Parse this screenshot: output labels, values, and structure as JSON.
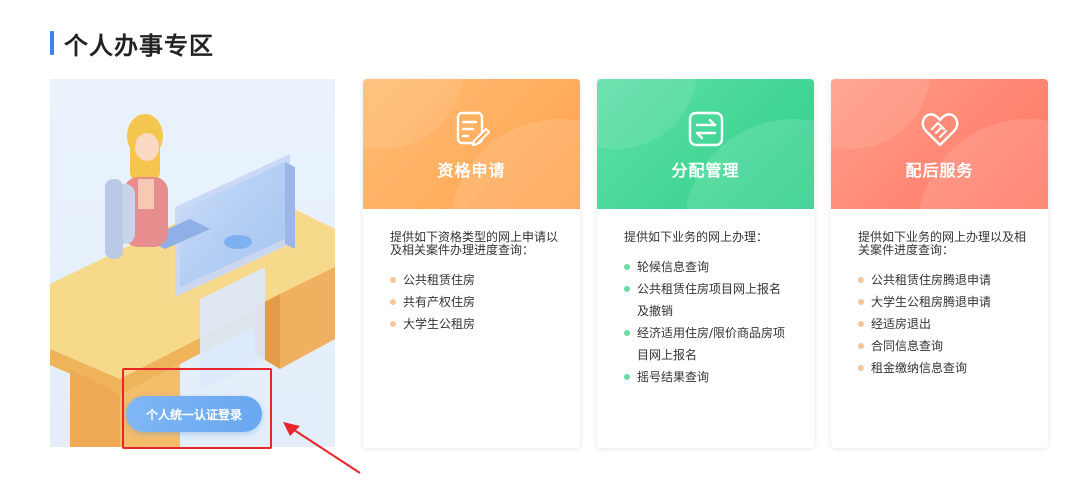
{
  "section": {
    "title": "个人办事专区"
  },
  "login": {
    "label": "个人统一认证登录"
  },
  "cards": [
    {
      "title": "资格申请",
      "icon": "form-edit-icon",
      "color": "#ffa24f",
      "dot_color": "#f7c59a",
      "desc": "提供如下资格类型的网上申请以及相关案件办理进度查询：",
      "items": [
        "公共租赁住房",
        "共有产权住房",
        "大学生公租房"
      ]
    },
    {
      "title": "分配管理",
      "icon": "exchange-arrows-icon",
      "color": "#2fcf8a",
      "dot_color": "#6fd9a6",
      "desc": "提供如下业务的网上办理：",
      "items": [
        "轮候信息查询",
        "公共租赁住房项目网上报名及撤销",
        "经济适用住房/限价商品房项目网上报名",
        "摇号结果查询"
      ]
    },
    {
      "title": "配后服务",
      "icon": "heart-handshake-icon",
      "color": "#ff7864",
      "dot_color": "#f7c59a",
      "desc": "提供如下业务的网上办理以及相关案件进度查询：",
      "items": [
        "公共租赁住房腾退申请",
        "大学生公租房腾退申请",
        "经适房退出",
        "合同信息查询",
        "租金缴纳信息查询"
      ]
    }
  ]
}
